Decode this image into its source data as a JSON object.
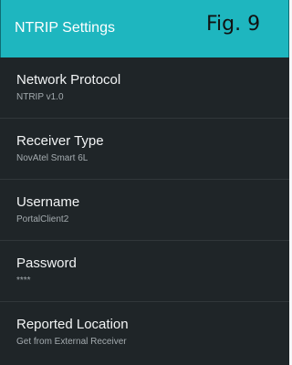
{
  "header": {
    "title": "NTRIP Settings",
    "figure_label": "Fig. 9"
  },
  "colors": {
    "header_background": "#1eb6bf",
    "list_background": "#1f2528",
    "title_text": "#f2f4f5",
    "value_text": "#a4abaf"
  },
  "settings": [
    {
      "title": "Network Protocol",
      "value": "NTRIP v1.0"
    },
    {
      "title": "Receiver Type",
      "value": "NovAtel Smart 6L"
    },
    {
      "title": "Username",
      "value": "PortalClient2"
    },
    {
      "title": "Password",
      "value": "****"
    },
    {
      "title": "Reported Location",
      "value": "Get from External Receiver"
    }
  ]
}
